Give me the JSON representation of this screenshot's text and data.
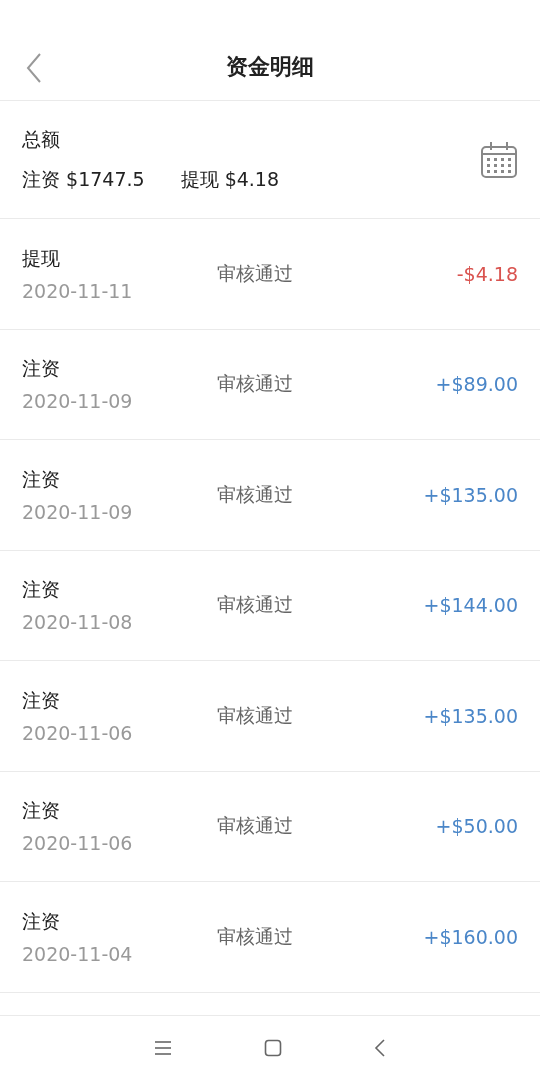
{
  "header": {
    "title": "资金明细"
  },
  "summary": {
    "label": "总额",
    "deposit": "注资 $1747.5",
    "withdraw": "提现 $4.18"
  },
  "records": [
    {
      "kind": "withdraw",
      "type": "提现",
      "date": "2020-11-11",
      "status": "审核通过",
      "amount": "-$4.18"
    },
    {
      "kind": "deposit",
      "type": "注资",
      "date": "2020-11-09",
      "status": "审核通过",
      "amount": "+$89.00"
    },
    {
      "kind": "deposit",
      "type": "注资",
      "date": "2020-11-09",
      "status": "审核通过",
      "amount": "+$135.00"
    },
    {
      "kind": "deposit",
      "type": "注资",
      "date": "2020-11-08",
      "status": "审核通过",
      "amount": "+$144.00"
    },
    {
      "kind": "deposit",
      "type": "注资",
      "date": "2020-11-06",
      "status": "审核通过",
      "amount": "+$135.00"
    },
    {
      "kind": "deposit",
      "type": "注资",
      "date": "2020-11-06",
      "status": "审核通过",
      "amount": "+$50.00"
    },
    {
      "kind": "deposit",
      "type": "注资",
      "date": "2020-11-04",
      "status": "审核通过",
      "amount": "+$160.00"
    }
  ]
}
